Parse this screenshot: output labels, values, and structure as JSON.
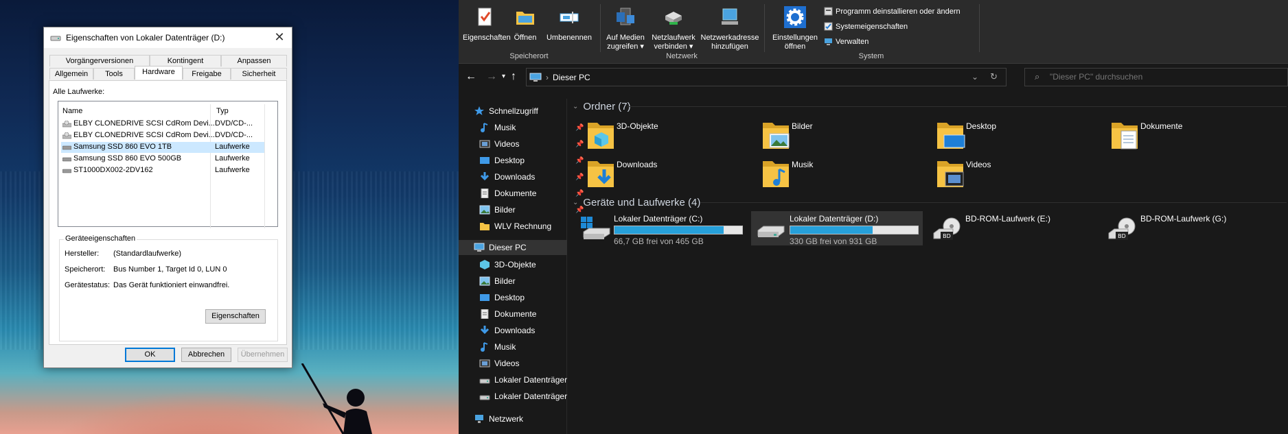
{
  "dialog": {
    "title": "Eigenschaften von Lokaler Datenträger (D:)",
    "tabs_top": [
      "Vorgängerversionen",
      "Kontingent",
      "Anpassen"
    ],
    "tabs_bottom": [
      "Allgemein",
      "Tools",
      "Hardware",
      "Freigabe",
      "Sicherheit"
    ],
    "active_tab": "Hardware",
    "all_drives_label": "Alle Laufwerke:",
    "columns": [
      "Name",
      "Typ"
    ],
    "drives": [
      {
        "name": "ELBY CLONEDRIVE SCSI CdRom Devi...",
        "type": "DVD/CD-...",
        "icon": "cdrom-icon"
      },
      {
        "name": "ELBY CLONEDRIVE SCSI CdRom Devi...",
        "type": "DVD/CD-...",
        "icon": "cdrom-icon"
      },
      {
        "name": "Samsung SSD 860 EVO 1TB",
        "type": "Laufwerke",
        "icon": "disk-icon"
      },
      {
        "name": "Samsung SSD 860 EVO 500GB",
        "type": "Laufwerke",
        "icon": "disk-icon"
      },
      {
        "name": "ST1000DX002-2DV162",
        "type": "Laufwerke",
        "icon": "disk-icon"
      }
    ],
    "selected_drive_index": 2,
    "device_props_title": "Geräteeigenschaften",
    "props": [
      {
        "label": "Hersteller:",
        "value": "(Standardlaufwerke)"
      },
      {
        "label": "Speicherort:",
        "value": "Bus Number 1, Target Id 0, LUN 0"
      },
      {
        "label": "Gerätestatus:",
        "value": "Das Gerät funktioniert einwandfrei."
      }
    ],
    "properties_button": "Eigenschaften",
    "ok": "OK",
    "cancel": "Abbrechen",
    "apply": "Übernehmen"
  },
  "ribbon": {
    "location": {
      "group": "Speicherort",
      "buttons": [
        "Eigenschaften",
        "Öffnen",
        "Umbenennen"
      ]
    },
    "network": {
      "group": "Netzwerk",
      "media": [
        "Auf Medien",
        "zugreifen ▾"
      ],
      "map_drive": [
        "Netzlaufwerk",
        "verbinden ▾"
      ],
      "add_location": [
        "Netzwerkadresse",
        "hinzufügen"
      ]
    },
    "system": {
      "group": "System",
      "settings": [
        "Einstellungen",
        "öffnen"
      ],
      "uninstall": "Programm deinstallieren oder ändern",
      "sysprops": "Systemeigenschaften",
      "manage": "Verwalten"
    }
  },
  "address": {
    "path": "Dieser PC",
    "search_placeholder": "\"Dieser PC\" durchsuchen"
  },
  "nav": {
    "quick_access": "Schnellzugriff",
    "quick_items": [
      {
        "label": "Musik",
        "icon": "music-icon",
        "pinned": true
      },
      {
        "label": "Videos",
        "icon": "video-icon",
        "pinned": true
      },
      {
        "label": "Desktop",
        "icon": "desktop-icon",
        "pinned": true
      },
      {
        "label": "Downloads",
        "icon": "download-icon",
        "pinned": true
      },
      {
        "label": "Dokumente",
        "icon": "document-icon",
        "pinned": true
      },
      {
        "label": "Bilder",
        "icon": "pictures-icon",
        "pinned": true
      },
      {
        "label": "WLV Rechnung",
        "icon": "folder-icon",
        "pinned": false
      }
    ],
    "this_pc": "Dieser PC",
    "pc_items": [
      {
        "label": "3D-Objekte",
        "icon": "3d-icon"
      },
      {
        "label": "Bilder",
        "icon": "pictures-icon"
      },
      {
        "label": "Desktop",
        "icon": "desktop-icon"
      },
      {
        "label": "Dokumente",
        "icon": "document-icon"
      },
      {
        "label": "Downloads",
        "icon": "download-icon"
      },
      {
        "label": "Musik",
        "icon": "music-icon"
      },
      {
        "label": "Videos",
        "icon": "video-icon"
      },
      {
        "label": "Lokaler Datenträger",
        "icon": "drive-icon"
      },
      {
        "label": "Lokaler Datenträger",
        "icon": "drive-icon"
      }
    ],
    "network": "Netzwerk"
  },
  "content": {
    "folders_header": "Ordner (7)",
    "folders": [
      {
        "label": "3D-Objekte",
        "icon": "3d-icon"
      },
      {
        "label": "Bilder",
        "icon": "pictures-icon"
      },
      {
        "label": "Desktop",
        "icon": "desktop-icon"
      },
      {
        "label": "Dokumente",
        "icon": "document-icon"
      },
      {
        "label": "Downloads",
        "icon": "download-icon"
      },
      {
        "label": "Musik",
        "icon": "music-icon"
      },
      {
        "label": "Videos",
        "icon": "video-icon"
      }
    ],
    "devices_header": "Geräte und Laufwerke (4)",
    "devices": [
      {
        "label": "Lokaler Datenträger (C:)",
        "free": "66,7 GB frei von 465 GB",
        "used_fraction": 0.857,
        "type": "system-drive"
      },
      {
        "label": "Lokaler Datenträger (D:)",
        "free": "330 GB frei von 931 GB",
        "used_fraction": 0.646,
        "type": "drive"
      },
      {
        "label": "BD-ROM-Laufwerk (E:)",
        "type": "bd"
      },
      {
        "label": "BD-ROM-Laufwerk (G:)",
        "type": "bd"
      }
    ]
  },
  "colors": {
    "accent": "#0078d7",
    "bar_fill": "#26a0da",
    "folder": "#f6c344",
    "explorer_bg": "#191919"
  }
}
